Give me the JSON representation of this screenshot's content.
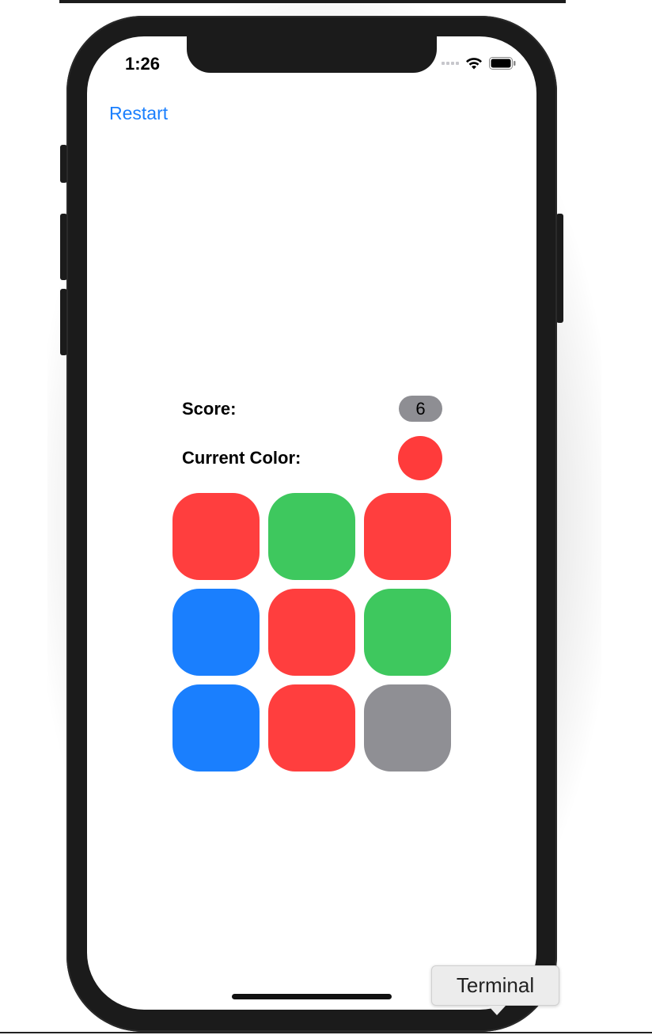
{
  "status_bar": {
    "time": "1:26",
    "icons": [
      "signal-icon",
      "wifi-icon",
      "battery-icon"
    ]
  },
  "nav": {
    "restart_label": "Restart"
  },
  "game": {
    "score_label": "Score:",
    "score_value": "6",
    "current_color_label": "Current Color:",
    "current_color": "#ff3b3b",
    "tiles": [
      {
        "color": "red"
      },
      {
        "color": "green"
      },
      {
        "color": "red"
      },
      {
        "color": "blue"
      },
      {
        "color": "red"
      },
      {
        "color": "green"
      },
      {
        "color": "blue"
      },
      {
        "color": "red"
      },
      {
        "color": "gray"
      }
    ]
  },
  "colors": {
    "red": "#ff3e3e",
    "green": "#3ec85e",
    "blue": "#1a7ffe",
    "gray": "#8f8f94",
    "link": "#1a7ffe",
    "badge": "#8e8e93"
  },
  "tooltip": {
    "text": "Terminal"
  }
}
